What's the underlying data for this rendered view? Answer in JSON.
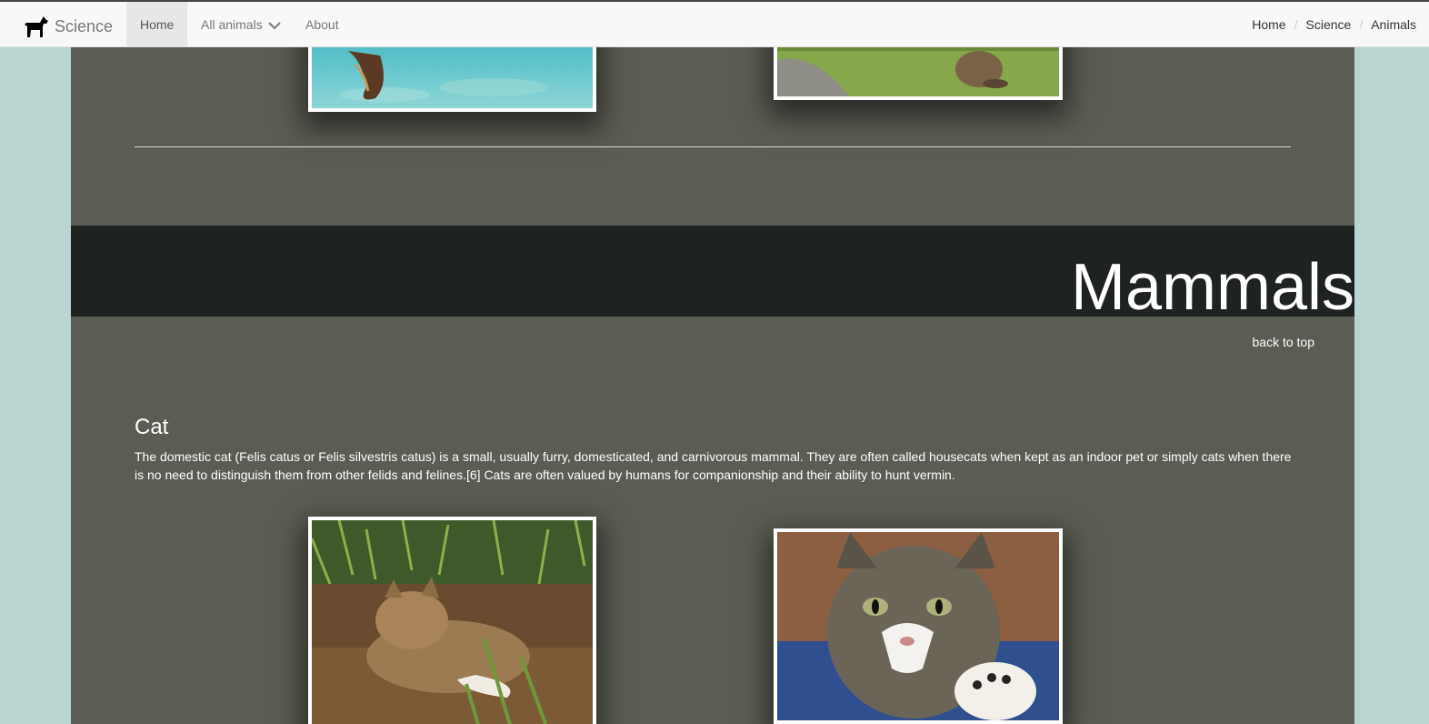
{
  "navbar": {
    "brand": "Science",
    "items": [
      {
        "label": "Home"
      },
      {
        "label": "All animals"
      },
      {
        "label": "About"
      }
    ],
    "breadcrumb": [
      "Home",
      "Science",
      "Animals"
    ],
    "icons": {
      "brand": "dog-icon",
      "dropdown": "chevron-down-icon"
    }
  },
  "section": {
    "title": "Mammals",
    "back_to_top": "back to top"
  },
  "animal": {
    "name": "Cat",
    "description": "The domestic cat (Felis catus or Felis silvestris catus) is a small, usually furry, domesticated, and carnivorous mammal. They are often called housecats when kept as an indoor pet or simply cats when there is no need to distinguish them from other felids and felines.[6] Cats are often valued by humans for companionship and their ability to hunt vermin."
  },
  "colors": {
    "page_background": "#b9d5d2",
    "content_background": "#5b5c53",
    "section_band": "#1e2220",
    "navbar": "#f8f8f8"
  }
}
